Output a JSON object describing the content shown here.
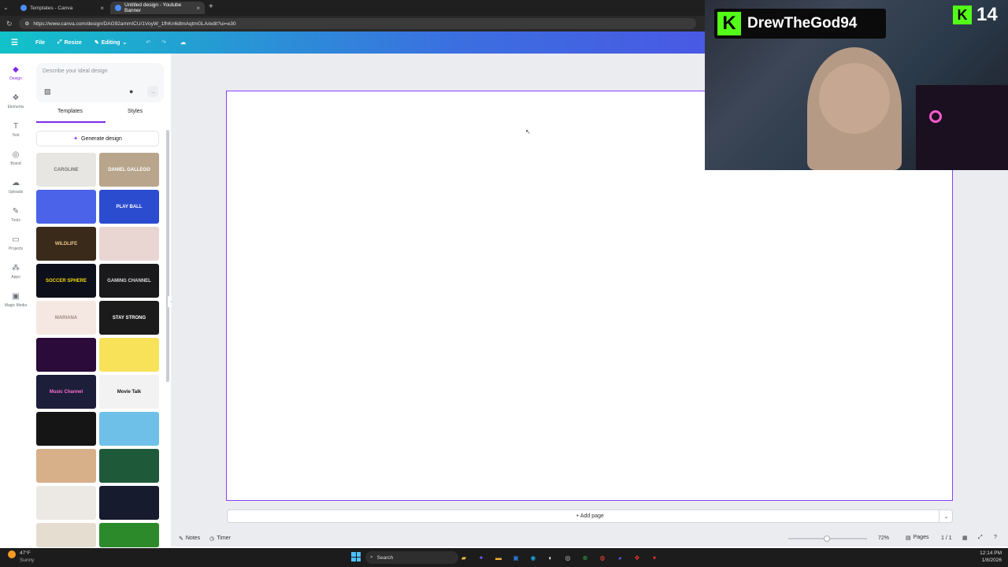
{
  "browser": {
    "tabs": [
      {
        "title": "Templates - Canva",
        "close": "×"
      },
      {
        "title": "Untitled design - Youtube Banner",
        "close": "×"
      }
    ],
    "new_tab": "+",
    "url": "https://www.canva.com/design/DAG92ammICU/1VoyW_1fhKn6dlmAqtmGLA/edit?ui=e30"
  },
  "header": {
    "menu_icon": "hamburger-icon",
    "file": "File",
    "resize": "Resize",
    "editing": "Editing"
  },
  "rail": {
    "items": [
      {
        "label": "Design",
        "icon": "design-icon",
        "glyph": "◆"
      },
      {
        "label": "Elements",
        "icon": "elements-icon",
        "glyph": "❖"
      },
      {
        "label": "Text",
        "icon": "text-icon",
        "glyph": "T"
      },
      {
        "label": "Brand",
        "icon": "brand-icon",
        "glyph": "◎"
      },
      {
        "label": "Uploads",
        "icon": "uploads-icon",
        "glyph": "☁"
      },
      {
        "label": "Tools",
        "icon": "tools-icon",
        "glyph": "✎"
      },
      {
        "label": "Projects",
        "icon": "projects-icon",
        "glyph": "▭"
      },
      {
        "label": "Apps",
        "icon": "apps-icon",
        "glyph": "⁂"
      },
      {
        "label": "Magic Media",
        "icon": "magic-media-icon",
        "glyph": "▣"
      }
    ]
  },
  "panel": {
    "prompt_placeholder": "Describe your ideal design",
    "tabs": [
      "Templates",
      "Styles"
    ],
    "generate": "Generate design",
    "templates": [
      {
        "text": "CAROLINE",
        "bg": "#e8e6e3",
        "fg": "#777"
      },
      {
        "text": "DANIEL GALLEGO",
        "bg": "#b8a58c",
        "fg": "#fff"
      },
      {
        "text": "",
        "bg": "#4a63e8",
        "fg": "#fff"
      },
      {
        "text": "PLAY BALL",
        "bg": "#2b4ccf",
        "fg": "#fff"
      },
      {
        "text": "WILDLIFE",
        "bg": "#3a2a1a",
        "fg": "#e8c58a"
      },
      {
        "text": "",
        "bg": "#e9d6d2",
        "fg": "#fff"
      },
      {
        "text": "SOCCER SPHERE",
        "bg": "#0d0f1a",
        "fg": "#f5d90a"
      },
      {
        "text": "GAMING CHANNEL",
        "bg": "#1a1a1d",
        "fg": "#ddd"
      },
      {
        "text": "MARIANA",
        "bg": "#f5e8e2",
        "fg": "#a08a80"
      },
      {
        "text": "STAY STRONG",
        "bg": "#1b1b1b",
        "fg": "#fff"
      },
      {
        "text": "",
        "bg": "#2a0b3a",
        "fg": "#ff38d0"
      },
      {
        "text": "",
        "bg": "#f7e25a",
        "fg": "#333"
      },
      {
        "text": "Music Channel",
        "bg": "#1d1e3a",
        "fg": "#ff6fcf"
      },
      {
        "text": "Movie Talk",
        "bg": "#f2f2f2",
        "fg": "#111"
      },
      {
        "text": "",
        "bg": "#151515",
        "fg": "#fff"
      },
      {
        "text": "",
        "bg": "#6fc0e8",
        "fg": "#fff"
      },
      {
        "text": "",
        "bg": "#d7b08a",
        "fg": "#fff"
      },
      {
        "text": "",
        "bg": "#1e5a3a",
        "fg": "#fff"
      },
      {
        "text": "",
        "bg": "#ece8e4",
        "fg": "#555"
      },
      {
        "text": "",
        "bg": "#171b2e",
        "fg": "#e33"
      },
      {
        "text": "",
        "bg": "#e5ddd0",
        "fg": "#555"
      },
      {
        "text": "",
        "bg": "#2c8a2a",
        "fg": "#f5e64a"
      }
    ]
  },
  "canvas": {
    "add_page": "+ Add page"
  },
  "bottom": {
    "notes": "Notes",
    "timer": "Timer",
    "zoom": "72%",
    "pages": "Pages",
    "page_count": "1 / 1"
  },
  "taskbar": {
    "weather_temp": "47°F",
    "weather_desc": "Sunny",
    "search": "Search",
    "time": "12:14 PM",
    "date": "1/8/2026"
  },
  "stream": {
    "handle": "DrewTheGod94",
    "count": "14"
  },
  "colors": {
    "accent": "#8b3dff",
    "kick_green": "#53fc18"
  }
}
